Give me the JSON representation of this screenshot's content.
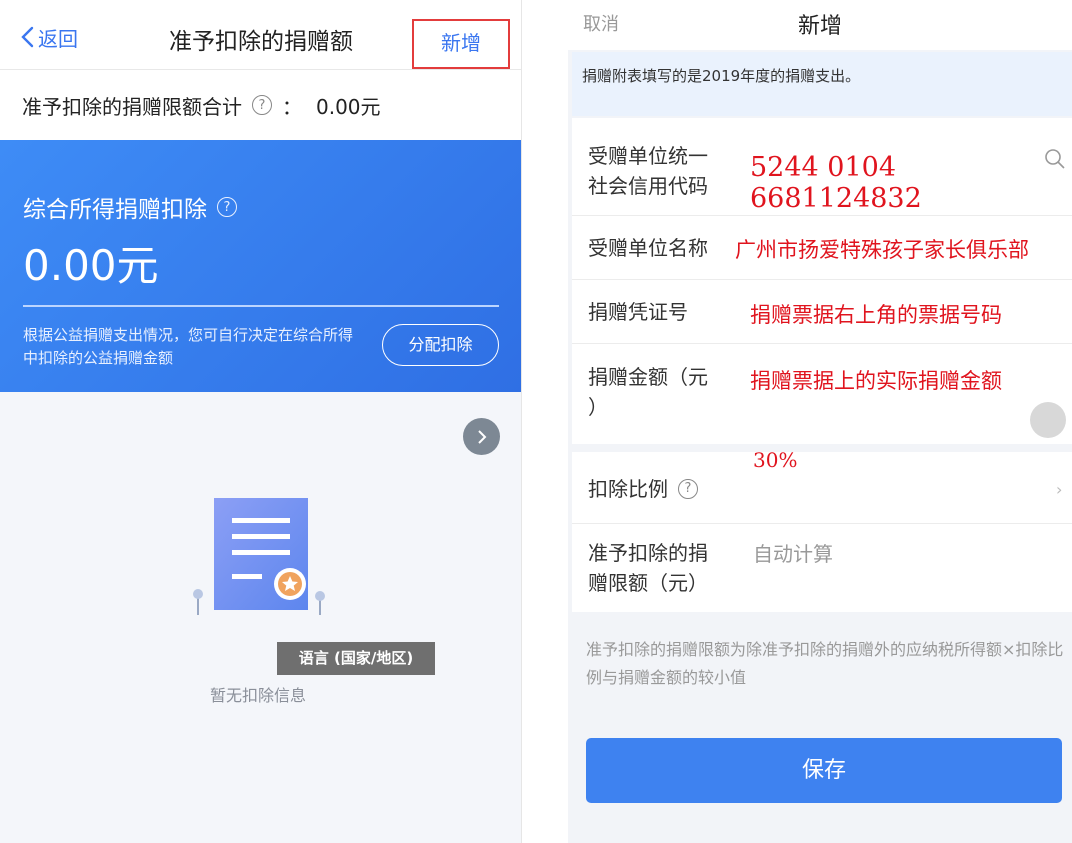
{
  "left": {
    "nav": {
      "back_label": "返回",
      "title": "准予扣除的捐赠额",
      "add_label": "新增"
    },
    "limit": {
      "label": "准予扣除的捐赠限额合计",
      "separator": "：",
      "value": "0.00元"
    },
    "card": {
      "title": "综合所得捐赠扣除",
      "amount": "0.00元",
      "description": "根据公益捐赠支出情况，您可自行决定在综合所得中扣除的公益捐赠金额",
      "allocate_label": "分配扣除"
    },
    "tooltip": "语言 (国家/地区)",
    "empty_text": "暂无扣除信息"
  },
  "right": {
    "nav": {
      "cancel_label": "取消",
      "title": "新增"
    },
    "notice": "捐赠附表填写的是2019年度的捐赠支出。",
    "form": {
      "credit_code_label_1": "受赠单位统一",
      "credit_code_label_2": "社会信用代码",
      "credit_code_value": "5244 0104 6681124832",
      "org_name_label": "受赠单位名称",
      "org_name_value": "广州市扬爱特殊孩子家长俱乐部",
      "voucher_label": "捐赠凭证号",
      "voucher_value": "捐赠票据右上角的票据号码",
      "amount_label_1": "捐赠金额（元",
      "amount_label_2": "）",
      "amount_value": "捐赠票据上的实际捐赠金额",
      "ratio_value": "30%",
      "ratio_label": "扣除比例",
      "limit_label_1": "准予扣除的捐",
      "limit_label_2": "赠限额（元）",
      "limit_value": "自动计算"
    },
    "explain": "准予扣除的捐赠限额为除准予扣除的捐赠外的应纳税所得额×扣除比例与捐赠金额的较小值",
    "save_label": "保存"
  },
  "colors": {
    "accent": "#3e82f0",
    "annotation_red": "#e0141e",
    "highlight_box": "#e33c3c"
  }
}
